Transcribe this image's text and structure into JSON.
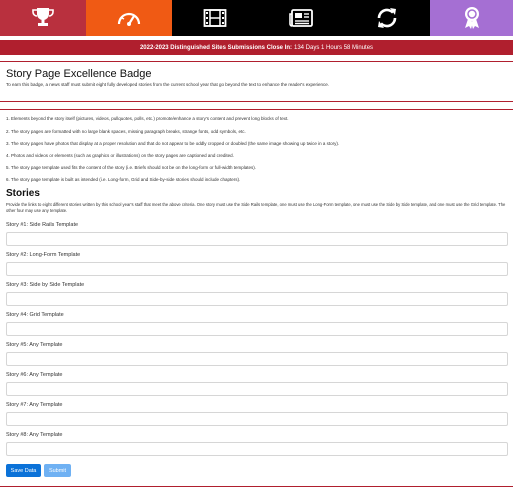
{
  "nav": {
    "tiles": [
      {
        "icon": "trophy-icon",
        "color": "#b9303e"
      },
      {
        "icon": "speedometer-icon",
        "color": "#f05a14"
      },
      {
        "icon": "film-icon",
        "color": "#000000"
      },
      {
        "icon": "newspaper-icon",
        "color": "#000000"
      },
      {
        "icon": "refresh-icon",
        "color": "#000000"
      },
      {
        "icon": "award-ribbon-icon",
        "color": "#a56fd3"
      }
    ]
  },
  "banner": {
    "label": "2022-2023 Distinguished Sites Submissions Close In:",
    "countdown": "134 Days 1 Hours 58 Minutes"
  },
  "badge": {
    "title": "Story Page Excellence Badge",
    "intro": "To earn this badge, a news staff must submit eight fully developed stories from the current school year that go beyond the text to enhance the reader's experience."
  },
  "criteria": [
    "1. Elements beyond the story itself (pictures, videos, pullquotes, polls, etc.) promote/enhance a story's content and prevent long blocks of text.",
    "2. The story pages are formatted with no large blank spaces, missing paragraph breaks, strange fonts, odd symbols, etc.",
    "3. The story pages have photos that display at a proper resolution and that do not appear to be oddly cropped or doubled (the same image showing up twice in a story).",
    "4. Photos and videos or elements (such as graphics or illustrations) on the story pages are captioned and credited.",
    "5. The story page template used fits the content of the story (i.e. Briefs should not be on the long-form or full-width templates).",
    "6. The story page template is built as intended (i.e. Long-form, Grid and Side-by-side stories should include chapters)."
  ],
  "stories": {
    "heading": "Stories",
    "description": "Provide the links to eight different stories written by this school year's staff that meet the above criteria. One story must use the Side Rails template, one must use the Long-Form template, one must use the Side by Side template, and one must use the Grid template. The other four may use any template.",
    "fields": [
      {
        "label": "Story #1: Side Rails Template",
        "value": ""
      },
      {
        "label": "Story #2: Long-Form Template",
        "value": ""
      },
      {
        "label": "Story #3: Side by Side Template",
        "value": ""
      },
      {
        "label": "Story #4: Grid Template",
        "value": ""
      },
      {
        "label": "Story #5: Any Template",
        "value": ""
      },
      {
        "label": "Story #6: Any Template",
        "value": ""
      },
      {
        "label": "Story #7: Any Template",
        "value": ""
      },
      {
        "label": "Story #8: Any Template",
        "value": ""
      }
    ]
  },
  "actions": {
    "save_label": "Save Data",
    "submit_label": "Submit"
  }
}
